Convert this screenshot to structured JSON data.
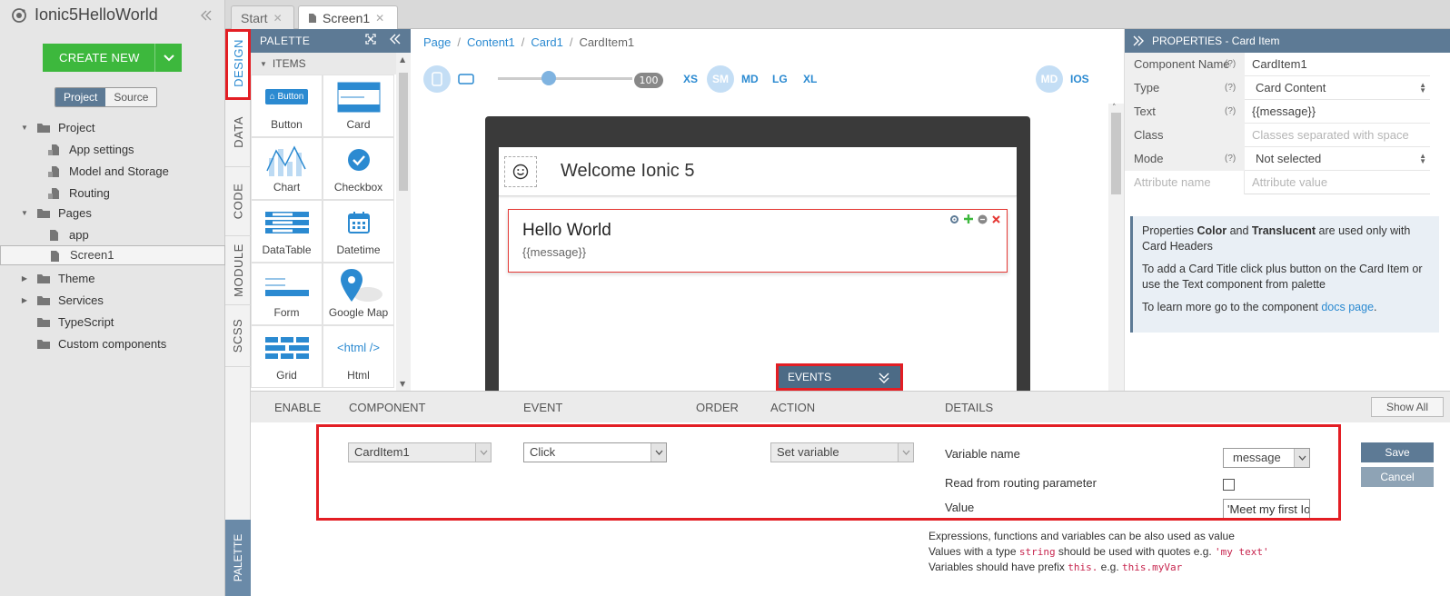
{
  "app": {
    "title": "Ionic5HelloWorld",
    "create_label": "CREATE NEW"
  },
  "left": {
    "toggle": {
      "project": "Project",
      "source": "Source"
    },
    "tree": [
      {
        "label": "Project"
      },
      {
        "label": "App settings"
      },
      {
        "label": "Model and Storage"
      },
      {
        "label": "Routing"
      },
      {
        "label": "Pages"
      },
      {
        "label": "app"
      },
      {
        "label": "Screen1"
      },
      {
        "label": "Theme"
      },
      {
        "label": "Services"
      },
      {
        "label": "TypeScript"
      },
      {
        "label": "Custom components"
      }
    ]
  },
  "tabs": {
    "start": "Start",
    "screen": "Screen1"
  },
  "side_tabs": {
    "design": "DESIGN",
    "data": "DATA",
    "code": "CODE",
    "module": "MODULE",
    "scss": "SCSS",
    "palette": "PALETTE"
  },
  "palette": {
    "title": "PALETTE",
    "section": "ITEMS",
    "items": [
      {
        "label": "Button",
        "mini": "Button"
      },
      {
        "label": "Card"
      },
      {
        "label": "Chart"
      },
      {
        "label": "Checkbox"
      },
      {
        "label": "DataTable"
      },
      {
        "label": "Datetime"
      },
      {
        "label": "Form"
      },
      {
        "label": "Google Map"
      },
      {
        "label": "Grid"
      },
      {
        "label": "Html",
        "mini": "<html />"
      }
    ]
  },
  "breadcrumb": {
    "page": "Page",
    "content": "Content1",
    "card": "Card1",
    "current": "CardItem1"
  },
  "canvas": {
    "zoom": "100",
    "breakpoints": {
      "xs": "XS",
      "sm": "SM",
      "md": "MD",
      "lg": "LG",
      "xl": "XL"
    },
    "mode_md": "MD",
    "mode_ios": "IOS",
    "heading": "Welcome Ionic 5",
    "card_title": "Hello World",
    "card_text": "{{message}}",
    "events_label": "EVENTS"
  },
  "properties": {
    "title": "PROPERTIES - Card Item",
    "rows": [
      {
        "key": "Component Name",
        "q": "(?)",
        "value": "CardItem1"
      },
      {
        "key": "Type",
        "q": "(?)",
        "value": "Card Content"
      },
      {
        "key": "Text",
        "q": "(?)",
        "value": "{{message}}"
      },
      {
        "key": "Class",
        "q": "",
        "value": "Classes separated with space"
      },
      {
        "key": "Mode",
        "q": "(?)",
        "value": "Not selected"
      },
      {
        "key": "Attribute name",
        "q": "",
        "value": "Attribute value"
      }
    ],
    "note": {
      "l1a": "Properties ",
      "l1b": "Color",
      "l1c": " and ",
      "l1d": "Translucent",
      "l1e": " are used only with Card Headers",
      "l2": "To add a Card Title click plus button on the Card Item or use the Text component from palette",
      "l3a": "To learn more go to the component ",
      "l3b": "docs page",
      "l3c": "."
    }
  },
  "events": {
    "headers": {
      "enable": "ENABLE",
      "component": "COMPONENT",
      "event": "EVENT",
      "order": "ORDER",
      "action": "ACTION",
      "details": "DETAILS"
    },
    "show_all": "Show All",
    "row": {
      "component": "CardItem1",
      "event": "Click",
      "action": "Set variable",
      "variable_label": "Variable name",
      "variable_value": "message",
      "routing_label": "Read from routing parameter",
      "value_label": "Value",
      "value": "'Meet my first Io"
    },
    "save": "Save",
    "cancel": "Cancel",
    "hints": {
      "h1": "Expressions, functions and variables can be also used as value",
      "h2a": "Values with a type ",
      "h2b": "string",
      "h2c": " should be used with quotes e.g. ",
      "h2d": "'my text'",
      "h3a": "Variables should have prefix ",
      "h3b": "this.",
      "h3c": " e.g. ",
      "h3d": "this.myVar"
    }
  }
}
